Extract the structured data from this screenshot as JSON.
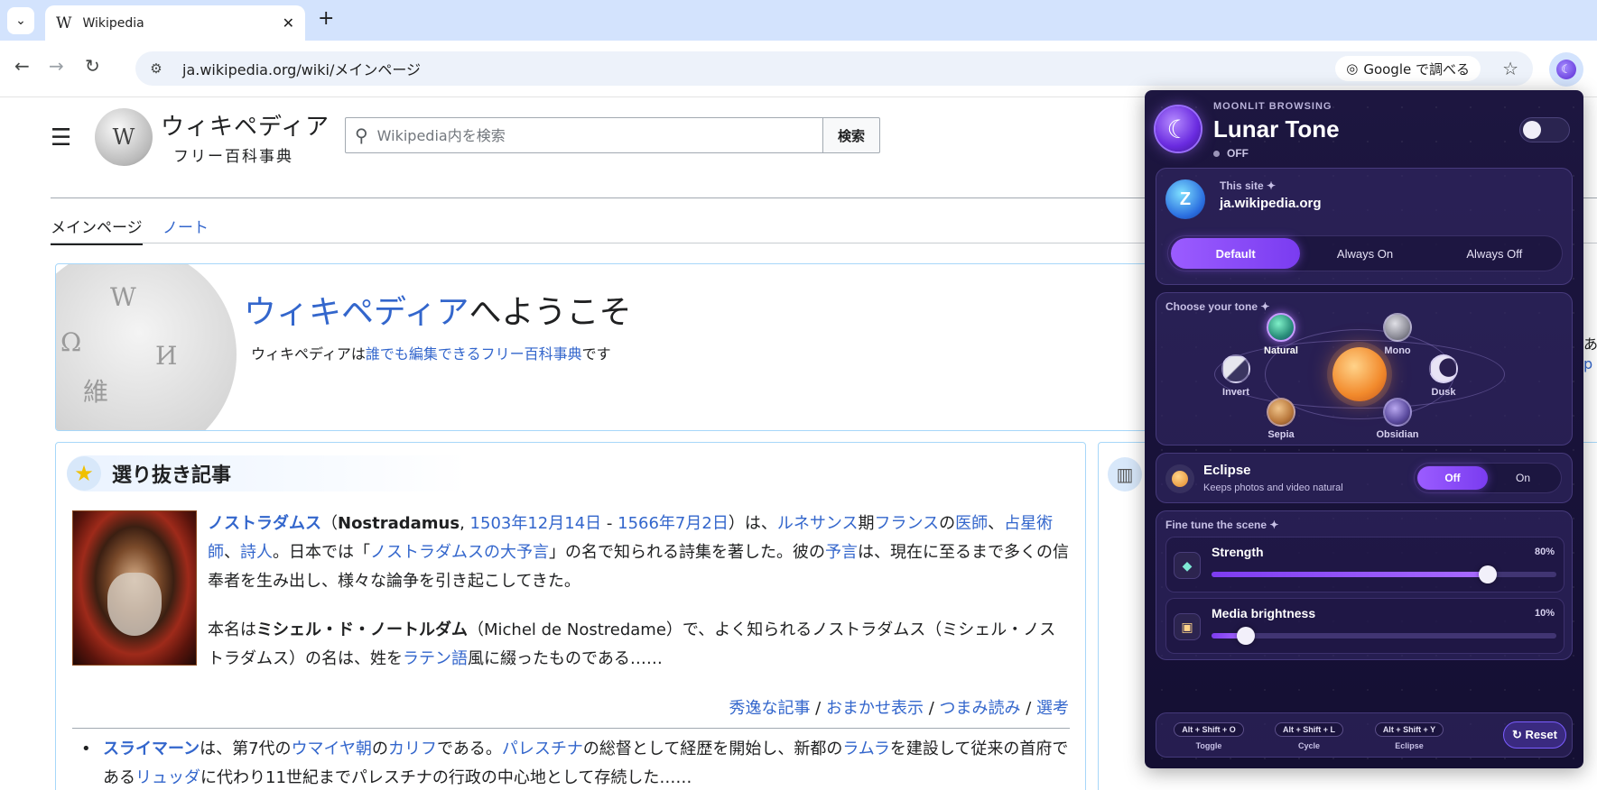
{
  "browser": {
    "tab_title": "Wikipedia",
    "tab_favicon": "W",
    "url": "ja.wikipedia.org/wiki/メインページ",
    "google_search_label": "Google で調べる"
  },
  "wiki": {
    "wordmark_main": "ウィキペディア",
    "wordmark_sub": "フリー百科事典",
    "search_placeholder": "Wikipedia内を検索",
    "search_button": "検索",
    "tab_main": "メインページ",
    "tab_talk": "ノート",
    "welcome": {
      "title_link": "ウィキペディア",
      "title_rest": "へようこそ",
      "tag_a": "ウィキペディアは",
      "tag_link": "誰でも編集できるフリー百科事典",
      "tag_b": "です"
    },
    "featured": {
      "heading": "選り抜き記事",
      "p1": {
        "t1": "ノストラダムス",
        "t2": "（",
        "t3": "Nostradamus",
        "t4": ", ",
        "t5": "1503年12月14日",
        "t6": " - ",
        "t7": "1566年7月2日",
        "t8": "）は、",
        "t9": "ルネサンス",
        "t10": "期",
        "t11": "フランス",
        "t12": "の",
        "t13": "医師",
        "t14": "、",
        "t15": "占星術師",
        "t16": "、",
        "t17": "詩人",
        "t18": "。日本では「",
        "t19": "ノストラダムスの大予言",
        "t20": "」の名で知られる詩集を著した。彼の",
        "t21": "予言",
        "t22": "は、現在に至るまで多くの信奉者を生み出し、様々な論争を引き起こしてきた。"
      },
      "p2": {
        "t1": "本名は",
        "t2": "ミシェル・ド・ノートルダム",
        "t3": "（Michel de Nostredame）で、よく知られるノストラダムス（ミシェル・ノストラダムス）の名は、姓を",
        "t4": "ラテン語",
        "t5": "風に綴ったものである……"
      },
      "more_links": [
        "秀逸な記事",
        "おまかせ表示",
        "つまみ読み",
        "選考"
      ],
      "more_sep": " / ",
      "bullet": {
        "t1": "スライマーン",
        "t2": "は、第7代の",
        "t3": "ウマイヤ朝",
        "t4": "の",
        "t5": "カリフ",
        "t6": "である。",
        "t7": "パレスチナ",
        "t8": "の総督として経歴を開始し、新都の",
        "t9": "ラムラ",
        "t10": "を建設して従来の首府である",
        "t11": "リュッダ",
        "t12": "に代わり11世紀までパレスチナの行政の中心地として存続した……"
      }
    },
    "peek_a": "あ",
    "peek_b": "p"
  },
  "extension": {
    "kicker": "MOONLIT BROWSING",
    "name": "Lunar Tone",
    "status": "OFF",
    "site": {
      "label": "This site ✦",
      "domain": "ja.wikipedia.org",
      "modes": [
        "Default",
        "Always On",
        "Always Off"
      ],
      "active_mode": 0
    },
    "tone": {
      "title": "Choose your tone ✦",
      "options": [
        "Natural",
        "Mono",
        "Invert",
        "Dusk",
        "Sepia",
        "Obsidian"
      ],
      "selected": "Natural"
    },
    "eclipse": {
      "title": "Eclipse",
      "subtitle": "Keeps photos and video natural",
      "off_label": "Off",
      "on_label": "On",
      "state": "Off"
    },
    "fine_tune": {
      "title": "Fine tune the scene ✦",
      "strength_label": "Strength",
      "strength_value_text": "80%",
      "strength_value": 80,
      "media_label": "Media brightness",
      "media_value_text": "10%",
      "media_value": 10
    },
    "shortcuts": [
      {
        "keys": "Alt + Shift + O",
        "caption": "Toggle"
      },
      {
        "keys": "Alt + Shift + L",
        "caption": "Cycle"
      },
      {
        "keys": "Alt + Shift + Y",
        "caption": "Eclipse"
      }
    ],
    "reset_label": "↻ Reset"
  },
  "colors": {
    "link": "#3366cc",
    "accent": "#9b5cff",
    "popup_bg": "#1d1640"
  }
}
